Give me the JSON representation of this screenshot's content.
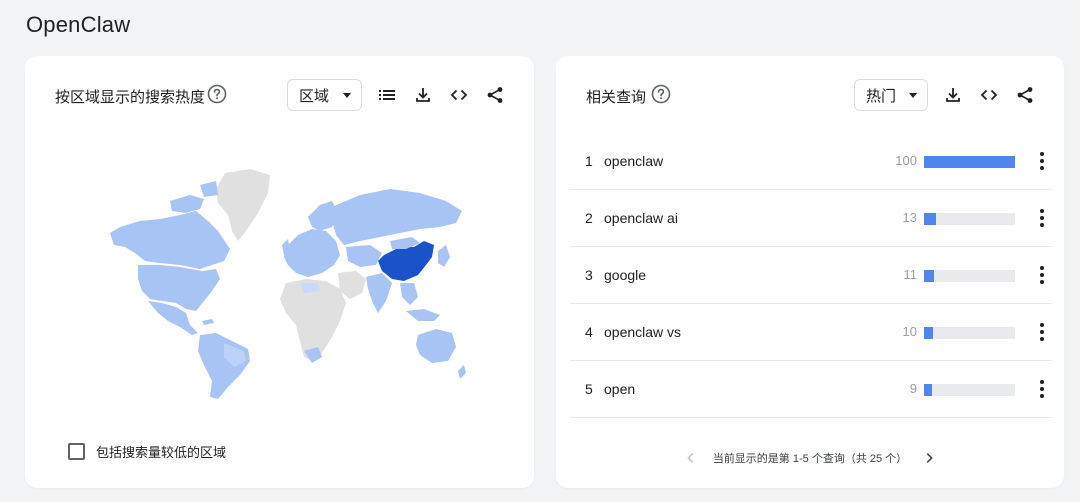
{
  "page": {
    "title": "OpenClaw"
  },
  "left_panel": {
    "title": "按区域显示的搜索热度",
    "select_value": "区域",
    "checkbox_label": "包括搜索量较低的区域",
    "map_colors": {
      "high": "#1a53c9",
      "mid": "#a8c4f5",
      "none": "#e0e0e0"
    }
  },
  "right_panel": {
    "title": "相关查询",
    "select_value": "热门",
    "rows": [
      {
        "rank": "1",
        "query": "openclaw",
        "value": "100",
        "score": 100
      },
      {
        "rank": "2",
        "query": "openclaw ai",
        "value": "13",
        "score": 13
      },
      {
        "rank": "3",
        "query": "google",
        "value": "11",
        "score": 11
      },
      {
        "rank": "4",
        "query": "openclaw vs",
        "value": "10",
        "score": 10
      },
      {
        "rank": "5",
        "query": "open",
        "value": "9",
        "score": 9
      }
    ],
    "pagination_text": "当前显示的是第 1-5 个查询（共 25 个）",
    "bar_color": "#4f86ec"
  },
  "icons": [
    "help-icon",
    "list-icon",
    "download-icon",
    "embed-code-icon",
    "share-icon",
    "chevron-left-icon",
    "chevron-right-icon",
    "more-vert-icon"
  ]
}
